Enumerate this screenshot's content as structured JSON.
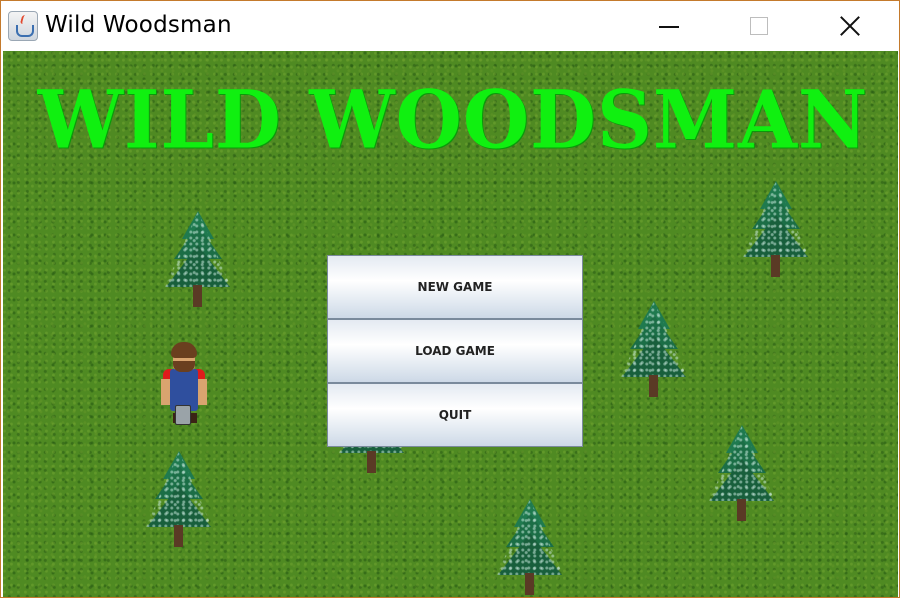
{
  "window": {
    "title": "Wild Woodsman",
    "icon": "java-cup-icon"
  },
  "game": {
    "title": "WILD WOODSMAN",
    "title_color": "#10f010",
    "grass_color": "#4f8a22"
  },
  "menu": {
    "new_game": "NEW GAME",
    "load_game": "LOAD GAME",
    "quit": "QUIT"
  }
}
